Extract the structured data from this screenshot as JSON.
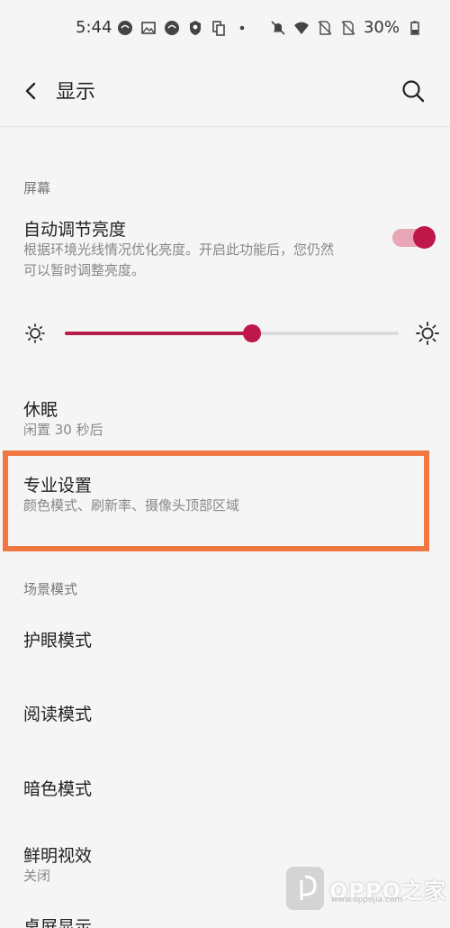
{
  "status_bar": {
    "time": "5:44",
    "battery": "30%"
  },
  "app_bar": {
    "title": "显示"
  },
  "sections": {
    "screen_header": "屏幕",
    "scene_header": "场景模式"
  },
  "items": {
    "auto_brightness": {
      "title": "自动调节亮度",
      "subtitle_line1": "根据环境光线情况优化亮度。开启此功能后，您仍然",
      "subtitle_line2": "可以暂时调整亮度。",
      "enabled": true
    },
    "brightness": {
      "level": 0.56
    },
    "sleep": {
      "title": "休眠",
      "subtitle": "闲置 30 秒后"
    },
    "pro_settings": {
      "title": "专业设置",
      "subtitle": "颜色模式、刷新率、摄像头顶部区域"
    },
    "eye_care": {
      "title": "护眼模式"
    },
    "reading": {
      "title": "阅读模式"
    },
    "dark": {
      "title": "暗色模式"
    },
    "vivid": {
      "title": "鲜明视效",
      "subtitle": "关闭"
    },
    "desktop": {
      "title": "桌屏显示"
    }
  },
  "watermark": {
    "text": "OPPO之家",
    "url": "www.oppojia.com"
  },
  "colors": {
    "accent": "#c0174b",
    "toggle_track": "#e8a6b7",
    "highlight": "#f07840",
    "background": "#f5f5f5"
  }
}
